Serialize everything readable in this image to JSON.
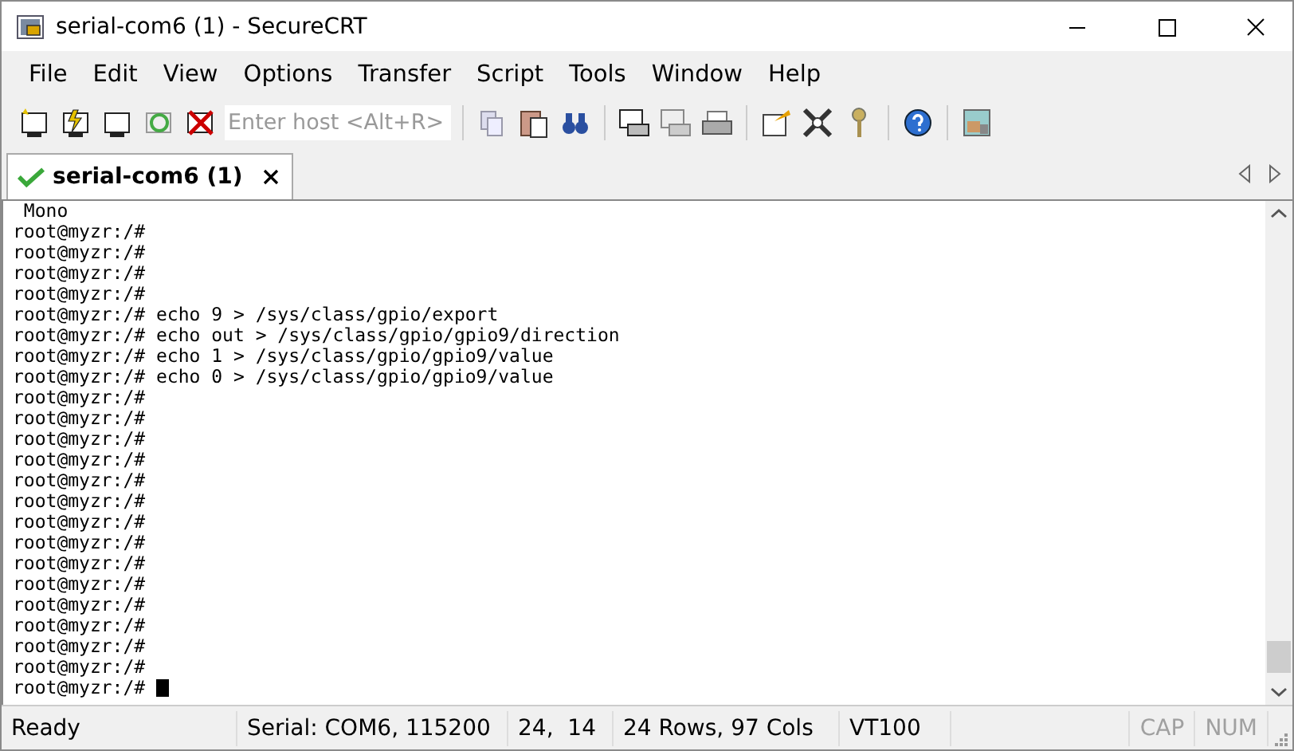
{
  "window": {
    "title": "serial-com6 (1) - SecureCRT"
  },
  "menu": [
    "File",
    "Edit",
    "View",
    "Options",
    "Transfer",
    "Script",
    "Tools",
    "Window",
    "Help"
  ],
  "toolbar": {
    "host_field": {
      "placeholder": "Enter host <Alt+R>"
    }
  },
  "tabs": [
    {
      "label": "serial-com6 (1)",
      "selected": true,
      "connected": true
    }
  ],
  "terminal": {
    "lines": [
      {
        "text": " Mono",
        "cursor": false
      },
      {
        "text": "root@myzr:/#",
        "cursor": false
      },
      {
        "text": "root@myzr:/#",
        "cursor": false
      },
      {
        "text": "root@myzr:/#",
        "cursor": false
      },
      {
        "text": "root@myzr:/#",
        "cursor": false
      },
      {
        "text": "root@myzr:/# echo 9 > /sys/class/gpio/export",
        "cursor": false
      },
      {
        "text": "root@myzr:/# echo out > /sys/class/gpio/gpio9/direction",
        "cursor": false
      },
      {
        "text": "root@myzr:/# echo 1 > /sys/class/gpio/gpio9/value",
        "cursor": false
      },
      {
        "text": "root@myzr:/# echo 0 > /sys/class/gpio/gpio9/value",
        "cursor": false
      },
      {
        "text": "root@myzr:/#",
        "cursor": false
      },
      {
        "text": "root@myzr:/#",
        "cursor": false
      },
      {
        "text": "root@myzr:/#",
        "cursor": false
      },
      {
        "text": "root@myzr:/#",
        "cursor": false
      },
      {
        "text": "root@myzr:/#",
        "cursor": false
      },
      {
        "text": "root@myzr:/#",
        "cursor": false
      },
      {
        "text": "root@myzr:/#",
        "cursor": false
      },
      {
        "text": "root@myzr:/#",
        "cursor": false
      },
      {
        "text": "root@myzr:/#",
        "cursor": false
      },
      {
        "text": "root@myzr:/#",
        "cursor": false
      },
      {
        "text": "root@myzr:/#",
        "cursor": false
      },
      {
        "text": "root@myzr:/#",
        "cursor": false
      },
      {
        "text": "root@myzr:/#",
        "cursor": false
      },
      {
        "text": "root@myzr:/#",
        "cursor": false
      },
      {
        "text": "root@myzr:/# ",
        "cursor": true
      }
    ]
  },
  "status_bar": [
    {
      "text": "Ready",
      "disabled": false
    },
    {
      "text": "Serial: COM6, 115200",
      "disabled": false
    },
    {
      "text": "24,  14",
      "disabled": false
    },
    {
      "text": "24 Rows, 97 Cols",
      "disabled": false
    },
    {
      "text": "VT100",
      "disabled": false
    },
    {
      "text": "CAP",
      "disabled": true
    },
    {
      "text": "NUM",
      "disabled": true
    }
  ]
}
